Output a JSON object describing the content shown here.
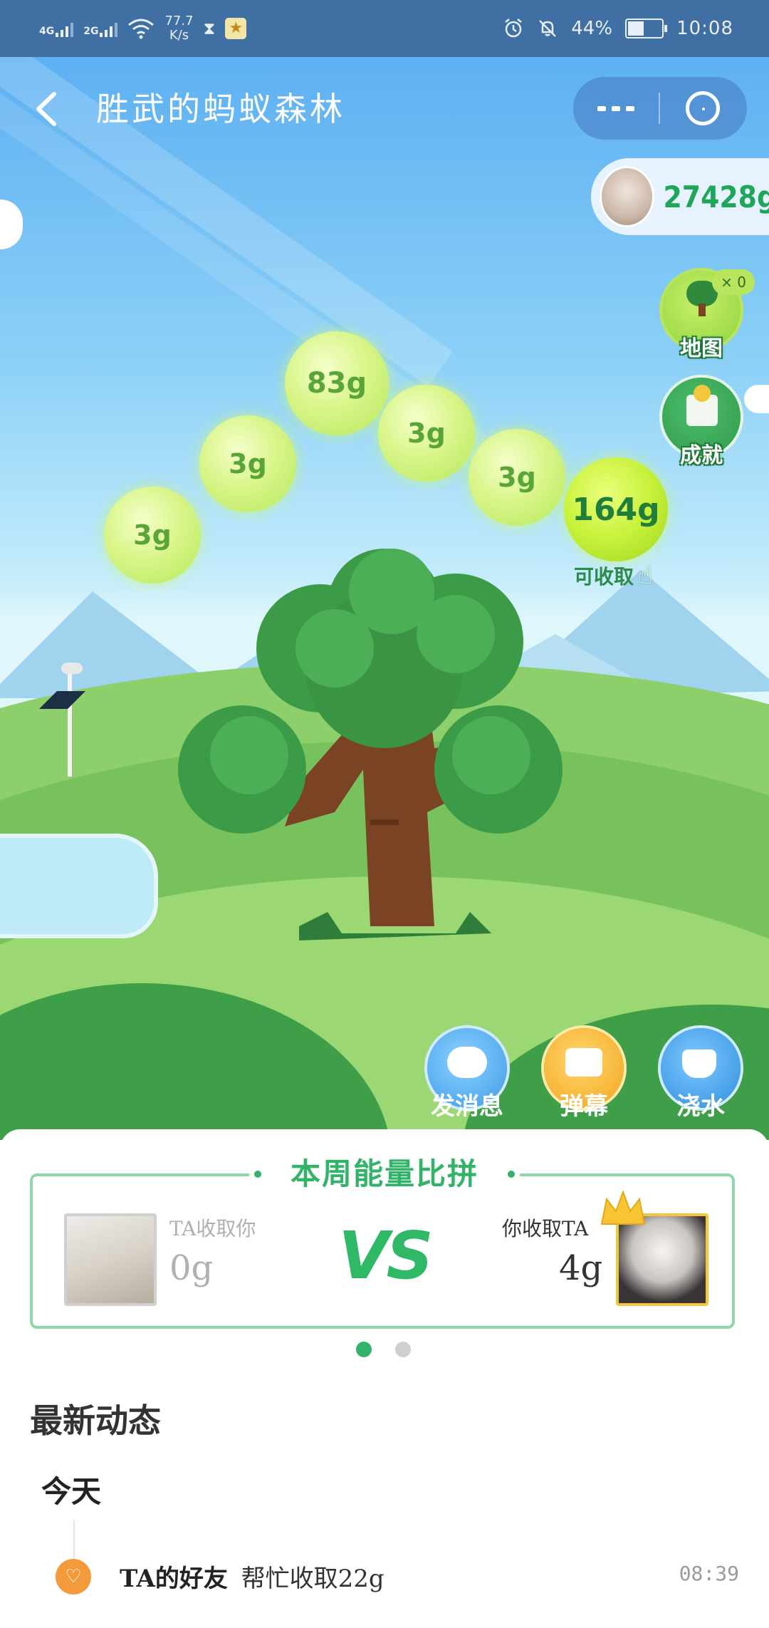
{
  "status_bar": {
    "sim1": "4G",
    "sim2": "2G",
    "speed_value": "77.7",
    "speed_unit": "K/s",
    "battery": "44%",
    "time": "10:08"
  },
  "header": {
    "title": "胜武的蚂蚁森林"
  },
  "energy_total": "27428g",
  "side_buttons": {
    "map_label": "地图",
    "map_badge": "× 0",
    "achieve_label": "成就"
  },
  "bubbles": [
    {
      "label": "3g"
    },
    {
      "label": "3g"
    },
    {
      "label": "83g"
    },
    {
      "label": "3g"
    },
    {
      "label": "3g"
    },
    {
      "label": "164g"
    }
  ],
  "collectible_hint": "可收取",
  "actions": {
    "message": "发消息",
    "danmaku": "弹幕",
    "water": "浇水"
  },
  "vs_card": {
    "title": "本周能量比拼",
    "left_caption": "TA收取你",
    "left_value": "0g",
    "vs_text": "VS",
    "right_caption": "你收取TA",
    "right_value": "4g"
  },
  "feed": {
    "heading": "最新动态",
    "today": "今天",
    "item": {
      "actor": "TA的好友",
      "action": "帮忙收取22g",
      "time": "08:39"
    }
  },
  "colors": {
    "status_bar": "#3f6fa3",
    "energy_green": "#1fa65a",
    "vs_green": "#33b36a",
    "crown": "#f2c73b"
  }
}
